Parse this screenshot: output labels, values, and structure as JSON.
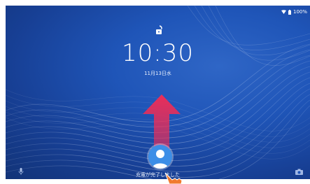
{
  "statusbar": {
    "battery_text": "100%"
  },
  "lockscreen": {
    "time": "10:30",
    "date": "11月13日水",
    "charging_status": "充電が完了しました"
  },
  "icons": {
    "status": [
      "wifi-icon",
      "battery-icon"
    ],
    "lock": "unlock-icon",
    "swipe": "swipe-up-arrow-icon",
    "user": "user-avatar-icon",
    "bottom_left": "mic-icon",
    "bottom_right": "camera-icon",
    "hand": "pointing-hand-icon"
  },
  "colors": {
    "background": "#1f55b8",
    "arrow": "#e02a55",
    "avatar": "#3c8ee7",
    "hand": "#f07a2e"
  }
}
